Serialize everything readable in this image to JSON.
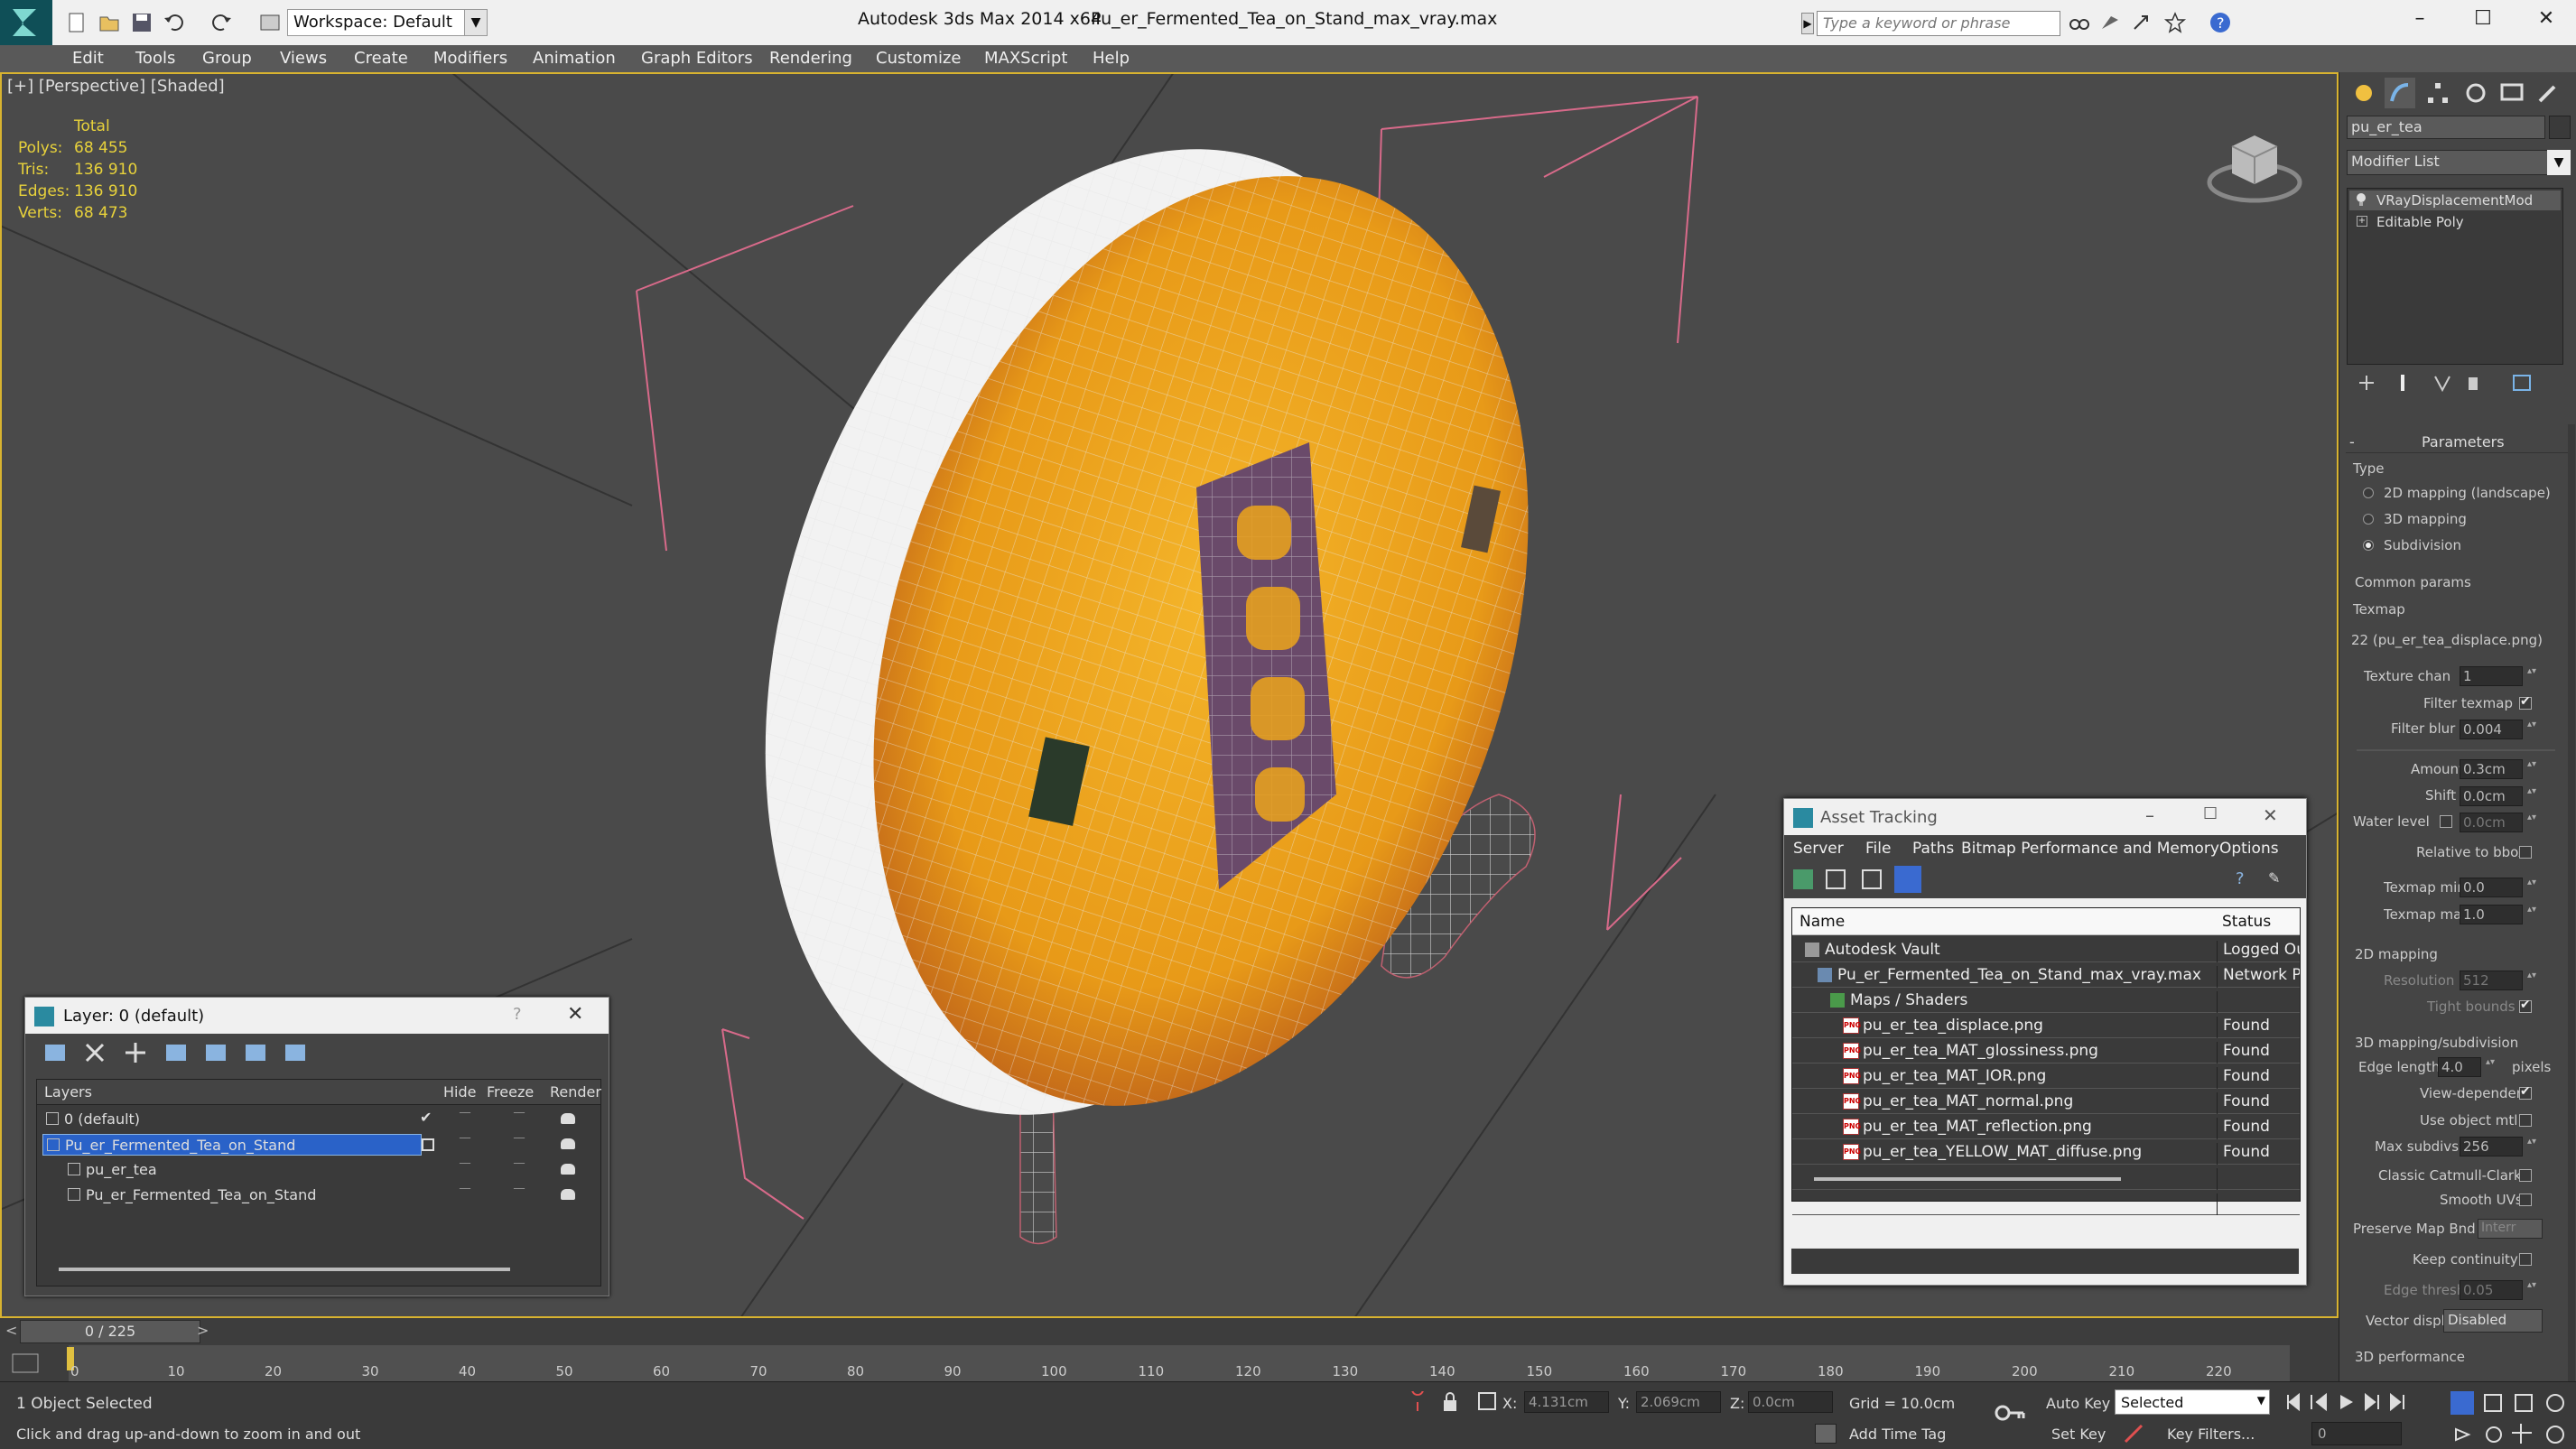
{
  "app": {
    "title": "Autodesk 3ds Max  2014 x64",
    "file": "Pu_er_Fermented_Tea_on_Stand_max_vray.max",
    "workspace": "Workspace: Default",
    "search_placeholder": "Type a keyword or phrase"
  },
  "menu": [
    "Edit",
    "Tools",
    "Group",
    "Views",
    "Create",
    "Modifiers",
    "Animation",
    "Graph Editors",
    "Rendering",
    "Customize",
    "MAXScript",
    "Help"
  ],
  "viewport": {
    "label": "[+] [Perspective] [Shaded]",
    "stats": {
      "total_label": "Total",
      "rows": [
        {
          "k": "Polys:",
          "v": "68 455"
        },
        {
          "k": "Tris:",
          "v": "136 910"
        },
        {
          "k": "Edges:",
          "v": "136 910"
        },
        {
          "k": "Verts:",
          "v": "68 473"
        }
      ]
    }
  },
  "command_panel": {
    "object_name": "pu_er_tea",
    "modifier_list": "Modifier List",
    "stack": [
      "VRayDisplacementMod",
      "Editable Poly"
    ],
    "parameters_title": "Parameters",
    "type_label": "Type",
    "type_options": [
      {
        "label": "2D mapping (landscape)",
        "selected": false
      },
      {
        "label": "3D mapping",
        "selected": false
      },
      {
        "label": "Subdivision",
        "selected": true
      }
    ],
    "common_params": "Common params",
    "texmap_label": "Texmap",
    "texmap_value": "22 (pu_er_tea_displace.png)",
    "texture_chan_label": "Texture chan",
    "texture_chan": "1",
    "filter_texmap": "Filter texmap",
    "filter_blur_label": "Filter blur",
    "filter_blur": "0.004",
    "amount_label": "Amount",
    "amount": "0.3cm",
    "shift_label": "Shift",
    "shift": "0.0cm",
    "water_level_label": "Water level",
    "water_level": "0.0cm",
    "relative_bbox": "Relative to bbox",
    "texmap_min_label": "Texmap min",
    "texmap_min": "0.0",
    "texmap_max_label": "Texmap max",
    "texmap_max": "1.0",
    "mapping2d_title": "2D mapping",
    "resolution_label": "Resolution",
    "resolution": "512",
    "tight_bounds": "Tight bounds",
    "mapping3d_title": "3D mapping/subdivision",
    "edge_length_label": "Edge length",
    "edge_length": "4.0",
    "pixels": "pixels",
    "view_dependent": "View-dependent",
    "use_object_mtl": "Use object mtl",
    "max_subdivs_label": "Max subdivs",
    "max_subdivs": "256",
    "classic_catmull": "Classic Catmull-Clark",
    "smooth_uvs": "Smooth UVs",
    "preserve_map_bnd": "Preserve Map Bnd",
    "preserve_value": "Interr",
    "keep_continuity": "Keep continuity",
    "edge_thresh_label": "Edge thresh",
    "edge_thresh": "0.05",
    "vector_displ_label": "Vector displ",
    "vector_displ": "Disabled",
    "perf_title": "3D performance"
  },
  "layer_dialog": {
    "title": "Layer: 0 (default)",
    "columns": [
      "Layers",
      "Hide",
      "Freeze",
      "Render"
    ],
    "rows": [
      {
        "name": "0 (default)",
        "indent": 0,
        "selected": false
      },
      {
        "name": "Pu_er_Fermented_Tea_on_Stand",
        "indent": 0,
        "selected": true
      },
      {
        "name": "pu_er_tea",
        "indent": 1,
        "selected": false
      },
      {
        "name": "Pu_er_Fermented_Tea_on_Stand",
        "indent": 1,
        "selected": false
      }
    ]
  },
  "asset_dialog": {
    "title": "Asset Tracking",
    "menu": [
      "Server",
      "File",
      "Paths",
      "Bitmap Performance and Memory",
      "Options"
    ],
    "col_name": "Name",
    "col_status": "Status",
    "rows": [
      {
        "name": "Autodesk Vault",
        "status": "Logged Out",
        "indent": 1,
        "kind": "vault"
      },
      {
        "name": "Pu_er_Fermented_Tea_on_Stand_max_vray.max",
        "status": "Network Pa",
        "indent": 2,
        "kind": "max"
      },
      {
        "name": "Maps / Shaders",
        "status": "",
        "indent": 3,
        "kind": "maps"
      },
      {
        "name": "pu_er_tea_displace.png",
        "status": "Found",
        "indent": 4,
        "kind": "png"
      },
      {
        "name": "pu_er_tea_MAT_glossiness.png",
        "status": "Found",
        "indent": 4,
        "kind": "png"
      },
      {
        "name": "pu_er_tea_MAT_IOR.png",
        "status": "Found",
        "indent": 4,
        "kind": "png"
      },
      {
        "name": "pu_er_tea_MAT_normal.png",
        "status": "Found",
        "indent": 4,
        "kind": "png"
      },
      {
        "name": "pu_er_tea_MAT_reflection.png",
        "status": "Found",
        "indent": 4,
        "kind": "png"
      },
      {
        "name": "pu_er_tea_YELLOW_MAT_diffuse.png",
        "status": "Found",
        "indent": 4,
        "kind": "png"
      }
    ]
  },
  "timeline": {
    "frame": "0 / 225",
    "ticks": [
      "0",
      "10",
      "20",
      "30",
      "40",
      "50",
      "60",
      "70",
      "80",
      "90",
      "100",
      "110",
      "120",
      "130",
      "140",
      "150",
      "160",
      "170",
      "180",
      "190",
      "200",
      "210",
      "220"
    ]
  },
  "status": {
    "selected": "1 Object Selected",
    "prompt": "Click and drag up-and-down to zoom in and out",
    "x_label": "X:",
    "x": "4.131cm",
    "y_label": "Y:",
    "y": "2.069cm",
    "z_label": "Z:",
    "z": "0.0cm",
    "grid": "Grid = 10.0cm",
    "add_time_tag": "Add Time Tag",
    "auto_key": "Auto Key",
    "set_key": "Set Key",
    "selected_filter": "Selected",
    "key_filters": "Key Filters...",
    "frame_value": "0"
  },
  "colors": {
    "viewport_border": "#d8b330",
    "stats": "#e8d23b",
    "selection": "#2a62c8",
    "tea_orange": "#e8a020"
  }
}
